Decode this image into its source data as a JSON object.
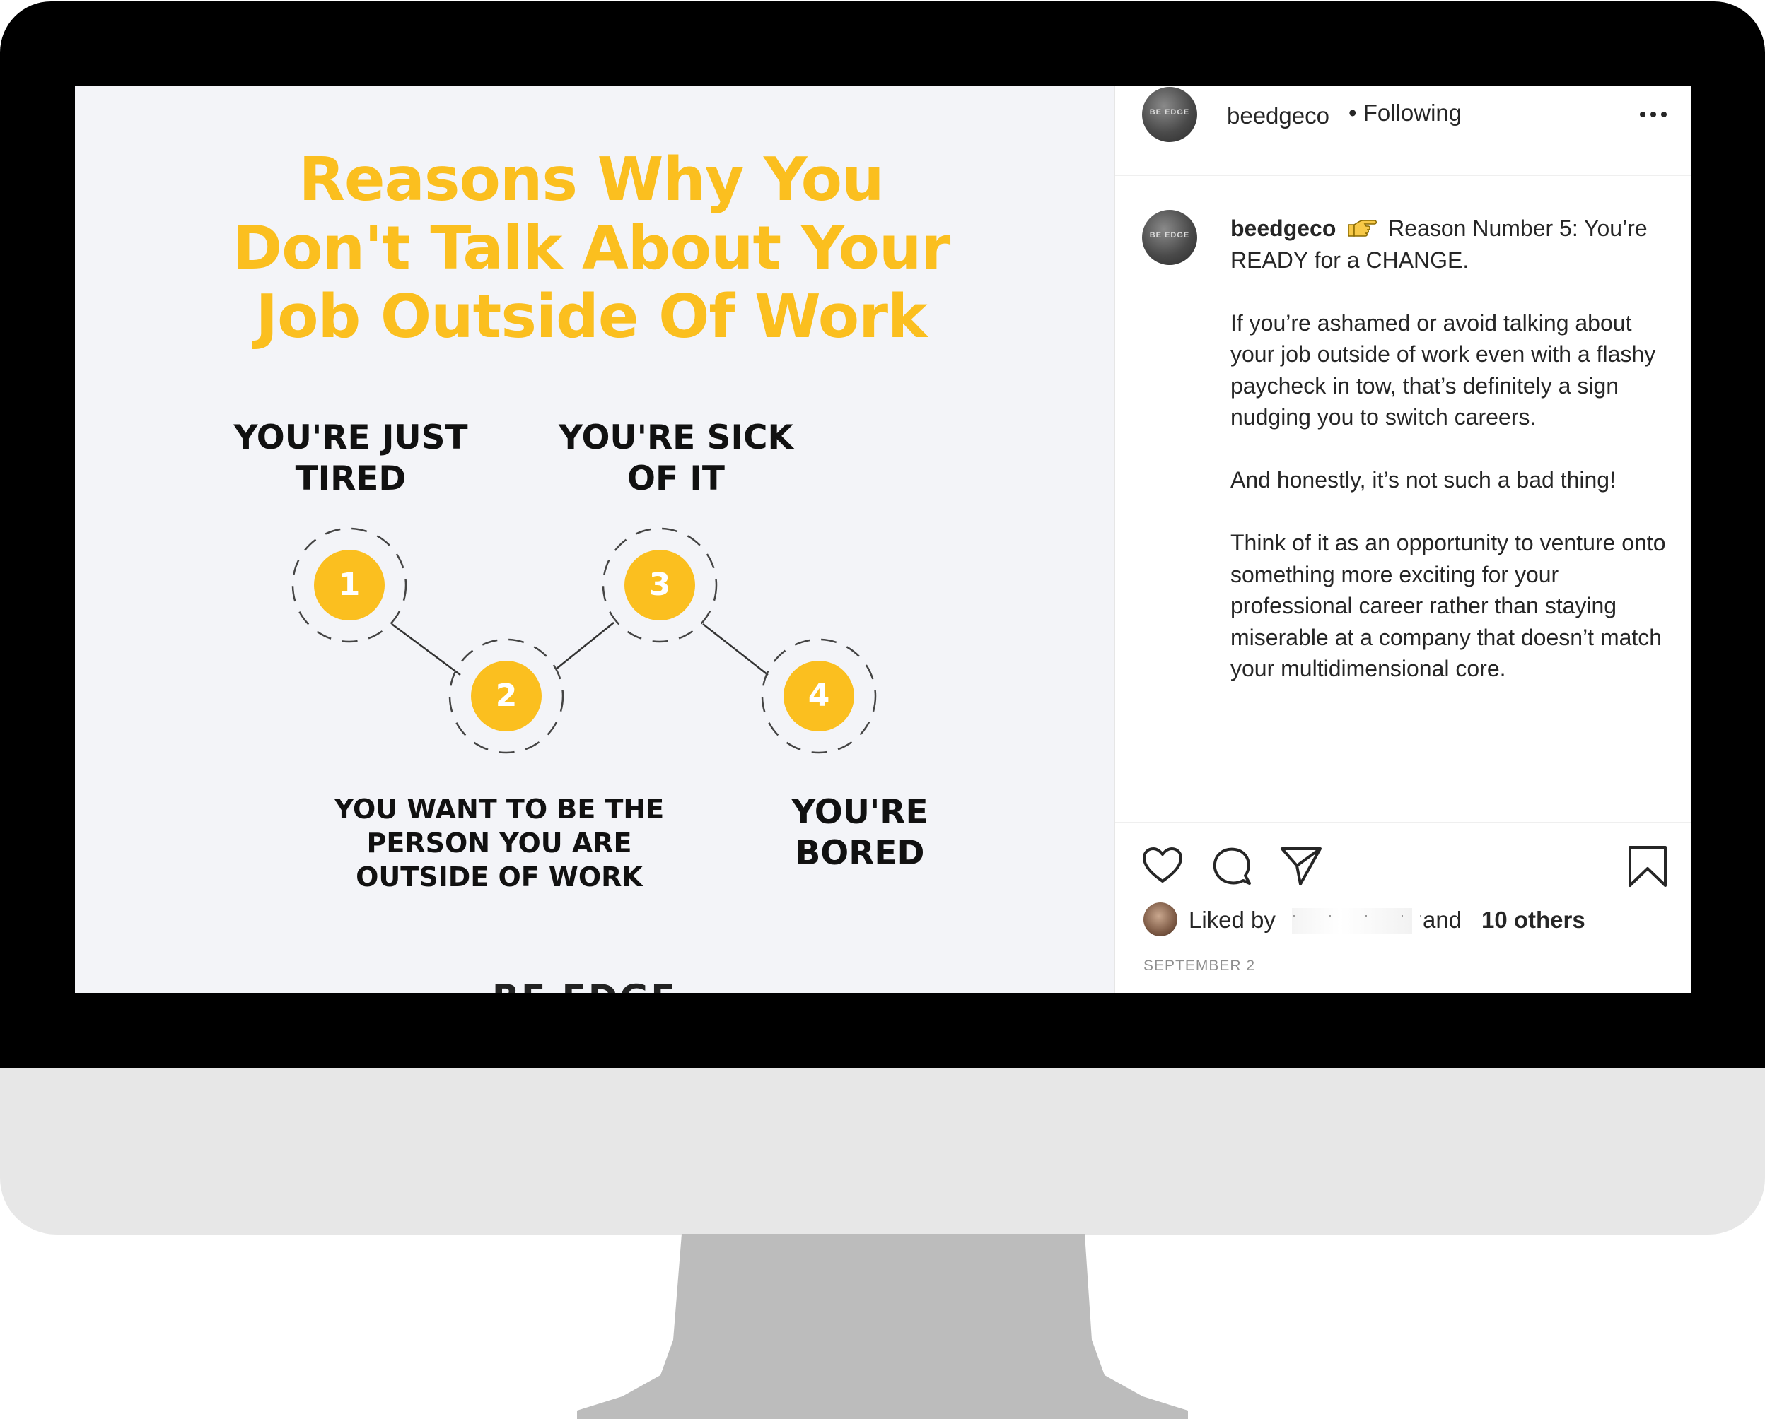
{
  "graphic": {
    "title_lines": [
      "Reasons Why You",
      "Don't Talk About Your",
      "Job Outside Of Work"
    ],
    "accent_color": "#fbbf1f",
    "steps": [
      {
        "number": "1",
        "label_lines": [
          "YOU'RE JUST",
          "TIRED"
        ]
      },
      {
        "number": "2",
        "label_lines": [
          "YOU WANT TO BE THE",
          "PERSON YOU ARE",
          "OUTSIDE OF WORK"
        ]
      },
      {
        "number": "3",
        "label_lines": [
          "YOU'RE SICK",
          "OF IT"
        ]
      },
      {
        "number": "4",
        "label_lines": [
          "YOU'RE",
          "BORED"
        ]
      }
    ],
    "brand_mark": "BE EDGE"
  },
  "header": {
    "username": "beedgeco",
    "following": "• Following",
    "avatar_logo": "BE EDGE",
    "more_icon": "more-horizontal-icon"
  },
  "caption": {
    "username": "beedgeco",
    "emoji_icon": "pointing-right-hand-icon",
    "first_line": "Reason Number 5: You’re READY for a CHANGE.",
    "paragraphs": [
      "If you’re ashamed or avoid talking about your job outside of work even with a flashy paycheck in tow, that’s definitely a sign nudging you to switch careers.",
      "And honestly, it’s not such a bad thing!",
      "Think of it as an opportunity to venture onto something more exciting for your professional career rather than staying miserable at a company that doesn’t match your multidimensional core."
    ]
  },
  "actions": {
    "icons": [
      "heart-icon",
      "comment-icon",
      "share-icon",
      "bookmark-icon"
    ]
  },
  "likes": {
    "prefix": "Liked by",
    "redacted_name": "· ·   · ·· ",
    "and": "and",
    "others": "10 others"
  },
  "date": "SEPTEMBER 2"
}
